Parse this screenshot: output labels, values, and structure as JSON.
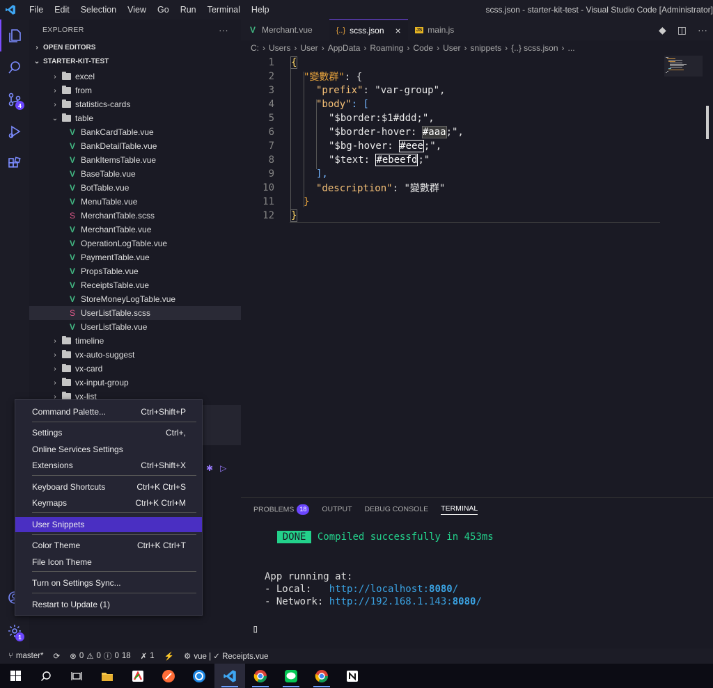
{
  "window_title": "scss.json - starter-kit-test - Visual Studio Code [Administrator]",
  "menu": [
    "File",
    "Edit",
    "Selection",
    "View",
    "Go",
    "Run",
    "Terminal",
    "Help"
  ],
  "activity": {
    "scm_badge": "4",
    "settings_badge": "1"
  },
  "sidebar": {
    "title": "EXPLORER",
    "more": "···",
    "open_editors": "OPEN EDITORS",
    "workspace": "STARTER-KIT-TEST",
    "tree": [
      {
        "label": "excel",
        "kind": "folder",
        "depth": 1
      },
      {
        "label": "from",
        "kind": "folder",
        "depth": 1
      },
      {
        "label": "statistics-cards",
        "kind": "folder",
        "depth": 1
      },
      {
        "label": "table",
        "kind": "folder-open",
        "depth": 1
      },
      {
        "label": "BankCardTable.vue",
        "kind": "vue",
        "depth": 2
      },
      {
        "label": "BankDetailTable.vue",
        "kind": "vue",
        "depth": 2
      },
      {
        "label": "BankItemsTable.vue",
        "kind": "vue",
        "depth": 2
      },
      {
        "label": "BaseTable.vue",
        "kind": "vue",
        "depth": 2
      },
      {
        "label": "BotTable.vue",
        "kind": "vue",
        "depth": 2
      },
      {
        "label": "MenuTable.vue",
        "kind": "vue",
        "depth": 2
      },
      {
        "label": "MerchantTable.scss",
        "kind": "scss",
        "depth": 2
      },
      {
        "label": "MerchantTable.vue",
        "kind": "vue",
        "depth": 2
      },
      {
        "label": "OperationLogTable.vue",
        "kind": "vue",
        "depth": 2
      },
      {
        "label": "PaymentTable.vue",
        "kind": "vue",
        "depth": 2
      },
      {
        "label": "PropsTable.vue",
        "kind": "vue",
        "depth": 2
      },
      {
        "label": "ReceiptsTable.vue",
        "kind": "vue",
        "depth": 2
      },
      {
        "label": "StoreMoneyLogTable.vue",
        "kind": "vue",
        "depth": 2
      },
      {
        "label": "UserListTable.scss",
        "kind": "scss",
        "depth": 2,
        "selected": true
      },
      {
        "label": "UserListTable.vue",
        "kind": "vue",
        "depth": 2
      },
      {
        "label": "timeline",
        "kind": "folder",
        "depth": 1
      },
      {
        "label": "vx-auto-suggest",
        "kind": "folder",
        "depth": 1
      },
      {
        "label": "vx-card",
        "kind": "folder",
        "depth": 1
      },
      {
        "label": "vx-input-group",
        "kind": "folder",
        "depth": 1
      },
      {
        "label": "vx-list",
        "kind": "folder",
        "depth": 1
      }
    ]
  },
  "tabs": [
    {
      "label": "Merchant.vue",
      "icon": "V",
      "active": false
    },
    {
      "label": "scss.json",
      "icon": "{..}",
      "active": true,
      "close": "×"
    },
    {
      "label": "main.js",
      "icon": "JS",
      "active": false
    }
  ],
  "breadcrumb": [
    "C:",
    "Users",
    "User",
    "AppData",
    "Roaming",
    "Code",
    "User",
    "snippets",
    "{..} scss.json",
    "..."
  ],
  "editor_lines": {
    "n": [
      "1",
      "2",
      "3",
      "4",
      "5",
      "6",
      "7",
      "8",
      "9",
      "10",
      "11",
      "12"
    ],
    "l2_key": "\"變數群\"",
    "l2_rest": ": {",
    "l3_key": "\"prefix\"",
    "l3_val": "\"var-group\"",
    "l4_key": "\"body\"",
    "l4_rest": ": [",
    "l5": "\"$border:$1#ddd;\",",
    "l6_a": "\"$border-hover: ",
    "l6_sel": "#aaa",
    "l6_b": ";\",",
    "l7_a": "\"$bg-hover: ",
    "l7_sel": "#eee",
    "l7_b": ";\",",
    "l8_a": "\"$text: ",
    "l8_sel": "#ebeefd",
    "l8_b": ";\"",
    "l9": "],",
    "l10_key": "\"description\"",
    "l10_val": "\"變數群\"",
    "l11": "}",
    "l1": "{",
    "l12": "}"
  },
  "panel": {
    "tabs": [
      {
        "label": "PROBLEMS",
        "badge": "18"
      },
      {
        "label": "OUTPUT"
      },
      {
        "label": "DEBUG CONSOLE"
      },
      {
        "label": "TERMINAL",
        "active": true
      }
    ],
    "done": "DONE",
    "compiled": "Compiled successfully in 453ms",
    "app_running": "App running at:",
    "local_label": "- Local:   ",
    "local_url": "http://localhost:",
    "local_port": "8080",
    "slash": "/",
    "network_label": "- Network: ",
    "network_url": "http://192.168.1.143:",
    "network_port": "8080",
    "cursor": "▯"
  },
  "context_menu": {
    "items": [
      {
        "label": "Command Palette...",
        "shortcut": "Ctrl+Shift+P"
      },
      {
        "label": "Settings",
        "shortcut": "Ctrl+,"
      },
      {
        "label": "Online Services Settings",
        "shortcut": ""
      },
      {
        "label": "Extensions",
        "shortcut": "Ctrl+Shift+X"
      },
      {
        "label": "Keyboard Shortcuts",
        "shortcut": "Ctrl+K Ctrl+S"
      },
      {
        "label": "Keymaps",
        "shortcut": "Ctrl+K Ctrl+M"
      },
      {
        "label": "User Snippets",
        "shortcut": "",
        "highlight": true
      },
      {
        "label": "Color Theme",
        "shortcut": "Ctrl+K Ctrl+T"
      },
      {
        "label": "File Icon Theme",
        "shortcut": ""
      },
      {
        "label": "Turn on Settings Sync...",
        "shortcut": ""
      },
      {
        "label": "Restart to Update (1)",
        "shortcut": ""
      }
    ]
  },
  "statusbar": {
    "branch": "master*",
    "errors": "0",
    "warnings_a": "0",
    "warnings_b": "0",
    "info": "18",
    "tools": "1",
    "lang": "vue | ✓ Receipts.vue"
  },
  "colors": {
    "accent": "#6b46ff",
    "highlight": "#4a2fc2",
    "vue": "#42b883",
    "done": "#23d18b"
  }
}
